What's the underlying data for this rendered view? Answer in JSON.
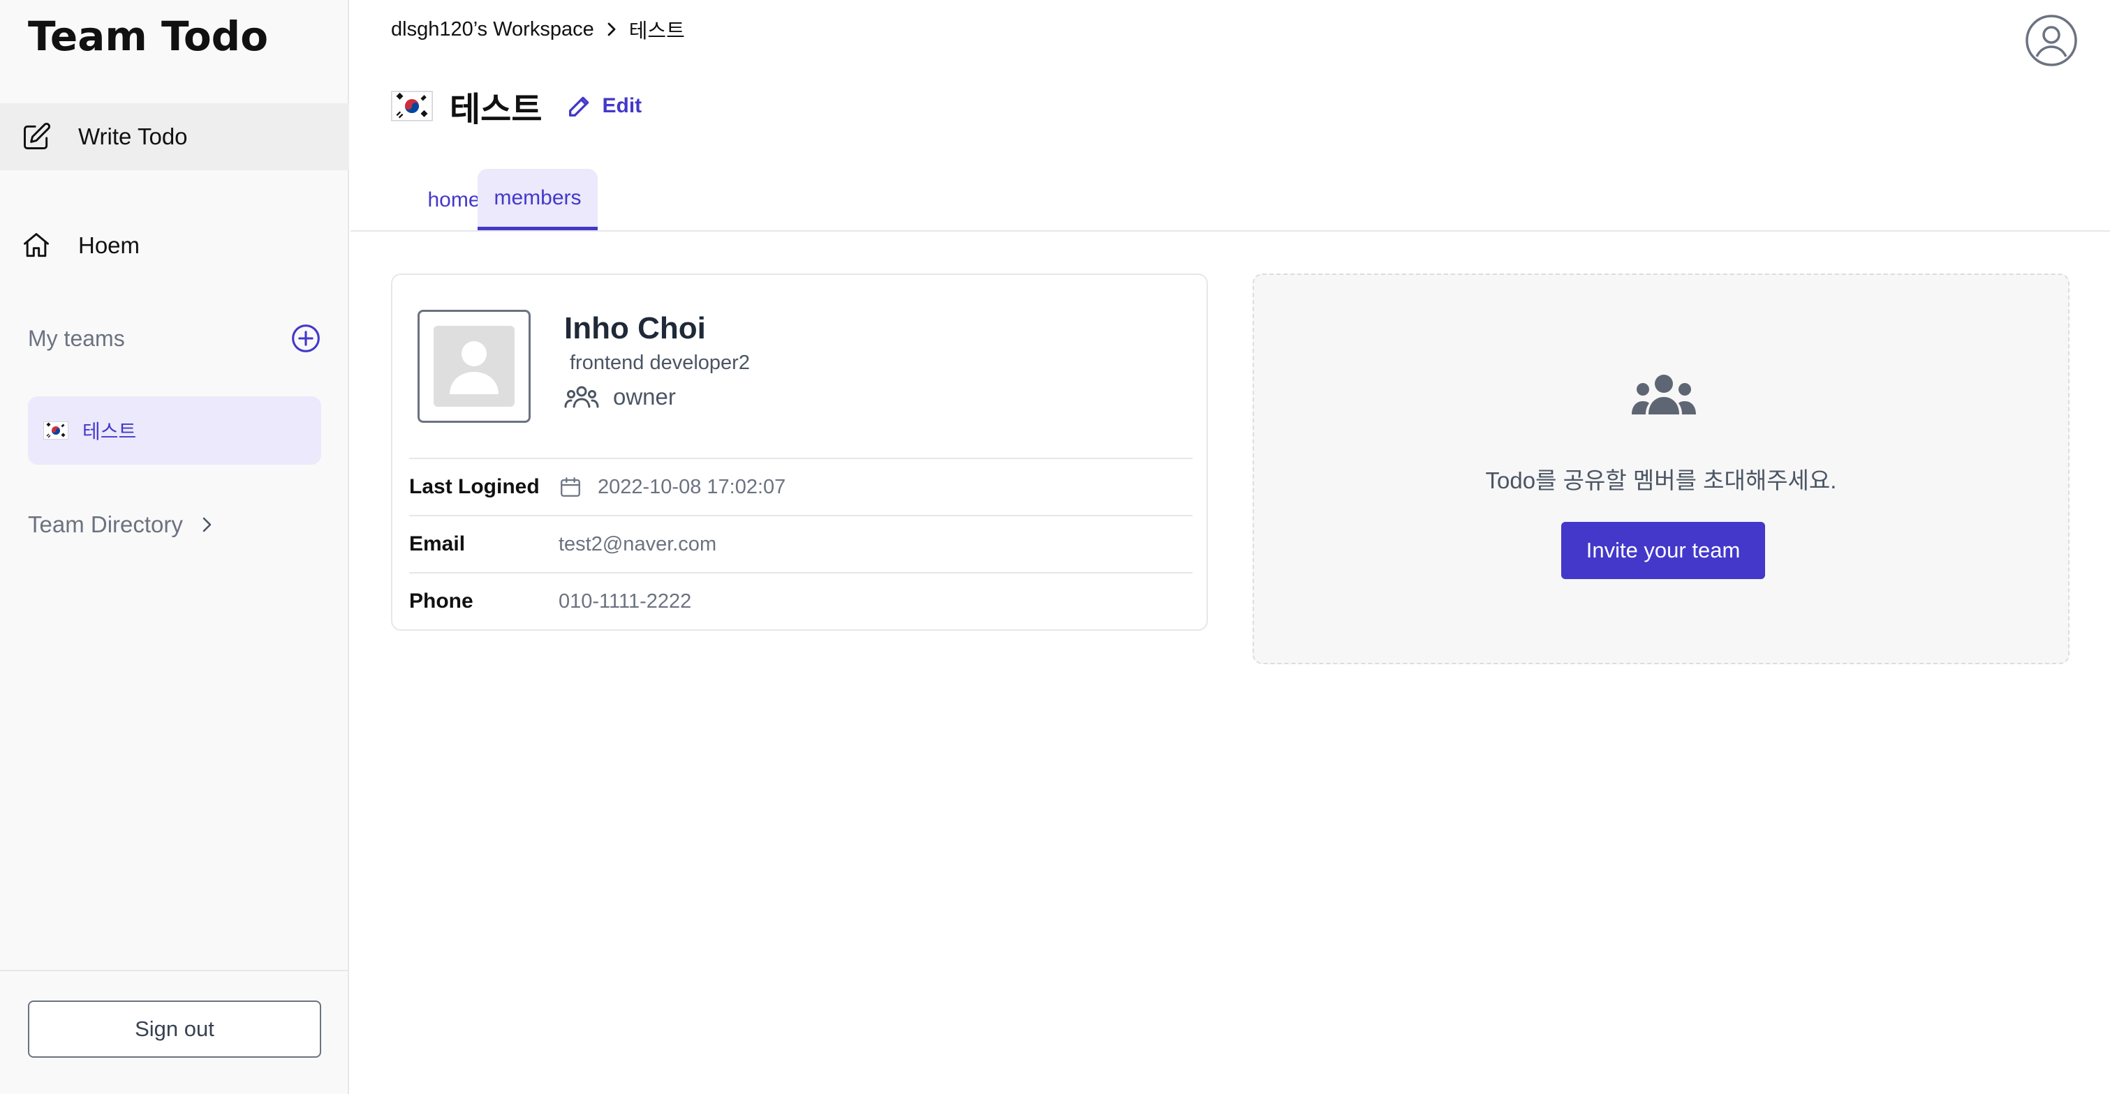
{
  "app": {
    "logo": "Team Todo"
  },
  "sidebar": {
    "write_todo": {
      "label": "Write Todo",
      "icon": "edit-square-icon"
    },
    "home": {
      "label": "Hoem",
      "icon": "home-icon"
    },
    "my_teams": {
      "label": "My teams",
      "add_icon": "plus-circle-icon"
    },
    "teams": [
      {
        "flag": "flag-kr-icon",
        "name": "테스트",
        "selected": true
      }
    ],
    "team_directory": {
      "label": "Team Directory",
      "icon": "chevron-right-icon"
    },
    "sign_out": "Sign out"
  },
  "header": {
    "breadcrumb": [
      "dlsgh120’s Workspace",
      "테스트"
    ],
    "avatar_icon": "user-circle-icon"
  },
  "team": {
    "flag": "flag-kr-icon",
    "name": "테스트",
    "edit_label": "Edit"
  },
  "tabs": [
    {
      "label": "home",
      "active": false
    },
    {
      "label": "members",
      "active": true
    }
  ],
  "member": {
    "name": "Inho Choi",
    "role": "frontend developer2",
    "permission": "owner",
    "fields": [
      {
        "key": "Last Logined",
        "value": "2022-10-08 17:02:07",
        "icon": "calendar-icon"
      },
      {
        "key": "Email",
        "value": "test2@naver.com"
      },
      {
        "key": "Phone",
        "value": "010-1111-2222"
      }
    ]
  },
  "invite": {
    "message": "Todo를 공유할 멤버를 초대해주세요.",
    "button": "Invite your team",
    "icon": "users-group-icon"
  },
  "colors": {
    "accent": "#4338ca",
    "accent_light": "#ebe9fb",
    "sidebar_bg": "#f9f9f9"
  }
}
